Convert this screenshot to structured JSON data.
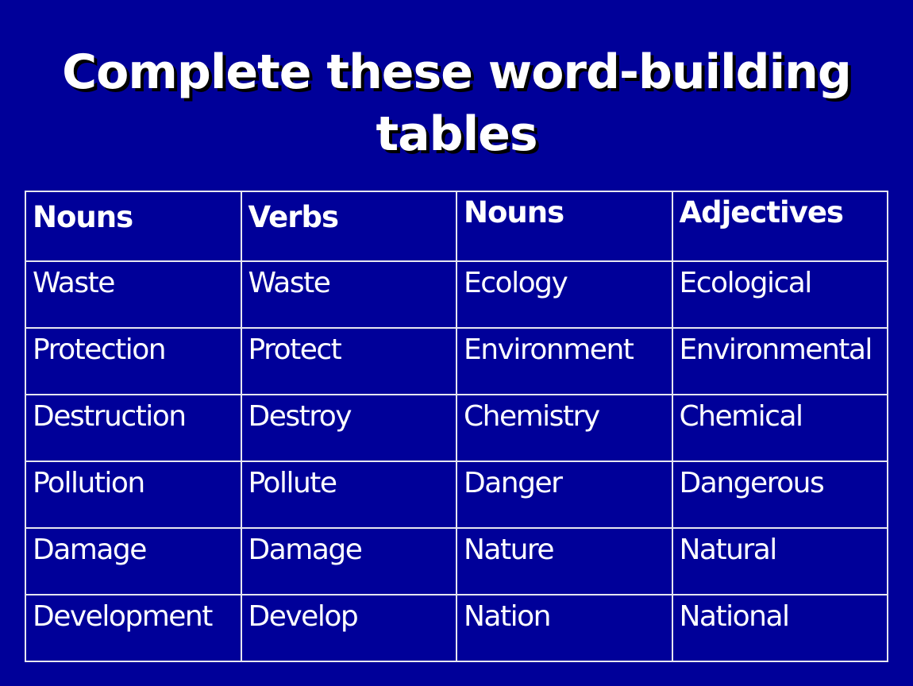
{
  "slide": {
    "title_line1": "Complete these word-building",
    "title_line2": "tables",
    "background_color": "#000099"
  },
  "table": {
    "headers": [
      "Nouns",
      "Verbs",
      "Nouns",
      "Adjectives"
    ],
    "rows": [
      [
        "Waste",
        "Waste",
        "Ecology",
        "Ecological"
      ],
      [
        "Protection",
        "Protect",
        "Environment",
        "Environmental"
      ],
      [
        "Destruction",
        "Destroy",
        "Chemistry",
        "Chemical"
      ],
      [
        "Pollution",
        "Pollute",
        "Danger",
        "Dangerous"
      ],
      [
        "Damage",
        "Damage",
        "Nature",
        "Natural"
      ],
      [
        "Development",
        "Develop",
        "Nation",
        "National"
      ]
    ]
  }
}
